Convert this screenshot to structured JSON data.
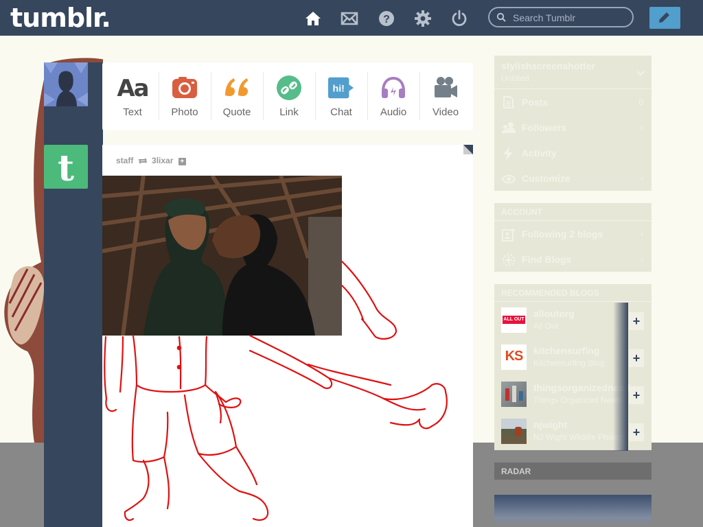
{
  "header": {
    "logo": "tumblr.",
    "search_placeholder": "Search Tumblr",
    "nav_icons": [
      "home-icon",
      "mail-icon",
      "help-icon",
      "gear-icon",
      "power-icon"
    ],
    "compose_icon": "pencil-icon"
  },
  "post_types": [
    {
      "label": "Text",
      "glyph": "Aa",
      "color": "#444444"
    },
    {
      "label": "Photo",
      "color": "#d95e40"
    },
    {
      "label": "Quote",
      "color": "#f2992e"
    },
    {
      "label": "Link",
      "color": "#56bc8a"
    },
    {
      "label": "Chat",
      "glyph": "hi!",
      "color": "#529ecc"
    },
    {
      "label": "Audio",
      "color": "#a77dc2"
    },
    {
      "label": "Video",
      "color": "#748089"
    }
  ],
  "post": {
    "author": "staff",
    "reblogged_from": "3lixar",
    "follow_glyph": "+"
  },
  "sidebar": {
    "blog": {
      "name": "stylishscreenshotter",
      "subtitle": "Untitled"
    },
    "blog_items": [
      {
        "label": "Posts",
        "count": "0",
        "icon": "posts-icon"
      },
      {
        "label": "Followers",
        "count": "›",
        "icon": "followers-icon"
      },
      {
        "label": "Activity",
        "count": "",
        "icon": "activity-icon"
      },
      {
        "label": "Customize",
        "count": "›",
        "icon": "eye-icon"
      }
    ],
    "account_header": "ACCOUNT",
    "account_items": [
      {
        "label": "Following 2 blogs",
        "icon": "following-icon"
      },
      {
        "label": "Find Blogs",
        "icon": "find-blogs-icon"
      }
    ],
    "recommended_header": "RECOMMENDED BLOGS",
    "recommended": [
      {
        "name": "alloutorg",
        "subtitle": "All Out",
        "avatar_text": "ALL OUT",
        "avatar_color": "#e8123c"
      },
      {
        "name": "kitchensurfing",
        "subtitle": "Kitchensurfing Blog",
        "avatar_text": "KS",
        "avatar_color": "#e24b1f"
      },
      {
        "name": "thingsorganizedneatly",
        "subtitle": "Things Organized Neatly",
        "avatar_text": "",
        "avatar_color": "#8a8d8e"
      },
      {
        "name": "njwight",
        "subtitle": "NJ Wight Wildlife Photography",
        "avatar_text": "",
        "avatar_color": "#7b7f72"
      }
    ],
    "add_glyph": "+",
    "radar_header": "RADAR"
  }
}
